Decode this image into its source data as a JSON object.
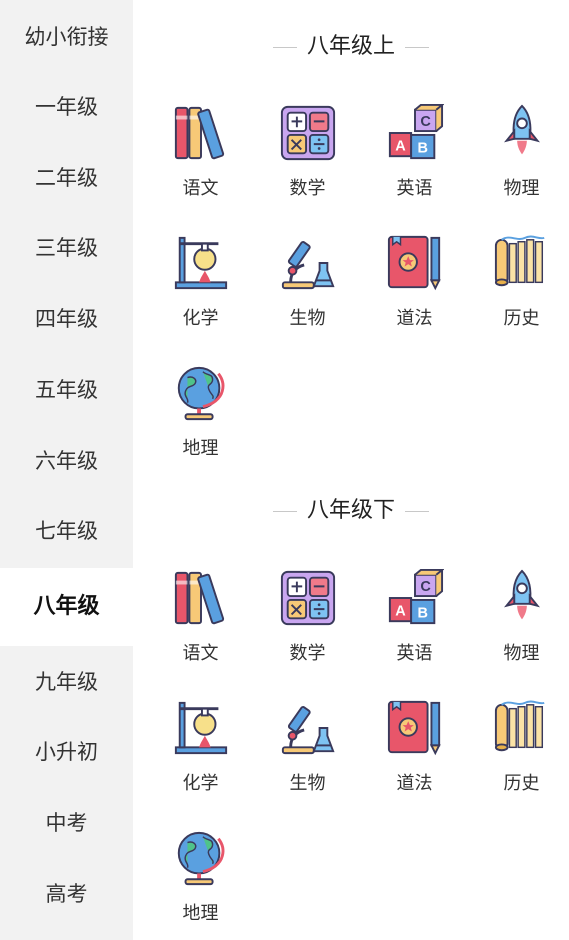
{
  "sidebar": {
    "items": [
      {
        "label": "幼小衔接"
      },
      {
        "label": "一年级"
      },
      {
        "label": "二年级"
      },
      {
        "label": "三年级"
      },
      {
        "label": "四年级"
      },
      {
        "label": "五年级"
      },
      {
        "label": "六年级"
      },
      {
        "label": "七年级"
      },
      {
        "label": "八年级",
        "selected": true
      },
      {
        "label": "九年级"
      },
      {
        "label": "小升初"
      },
      {
        "label": "中考"
      },
      {
        "label": "高考"
      }
    ]
  },
  "sections": [
    {
      "title": "八年级上",
      "subjects": [
        {
          "label": "语文",
          "icon": "books-icon"
        },
        {
          "label": "数学",
          "icon": "calculator-icon"
        },
        {
          "label": "英语",
          "icon": "abc-blocks-icon"
        },
        {
          "label": "物理",
          "icon": "rocket-icon"
        },
        {
          "label": "化学",
          "icon": "flask-stand-icon"
        },
        {
          "label": "生物",
          "icon": "microscope-icon"
        },
        {
          "label": "道法",
          "icon": "book-pencil-icon"
        },
        {
          "label": "历史",
          "icon": "bamboo-scroll-icon"
        },
        {
          "label": "地理",
          "icon": "globe-icon"
        }
      ]
    },
    {
      "title": "八年级下",
      "subjects": [
        {
          "label": "语文",
          "icon": "books-icon"
        },
        {
          "label": "数学",
          "icon": "calculator-icon"
        },
        {
          "label": "英语",
          "icon": "abc-blocks-icon"
        },
        {
          "label": "物理",
          "icon": "rocket-icon"
        },
        {
          "label": "化学",
          "icon": "flask-stand-icon"
        },
        {
          "label": "生物",
          "icon": "microscope-icon"
        },
        {
          "label": "道法",
          "icon": "book-pencil-icon"
        },
        {
          "label": "历史",
          "icon": "bamboo-scroll-icon"
        },
        {
          "label": "地理",
          "icon": "globe-icon"
        }
      ]
    }
  ],
  "colors": {
    "sidebar_bg": "#f2f2f2",
    "active_bg": "#ffffff",
    "outline": "#3a3a5c"
  }
}
